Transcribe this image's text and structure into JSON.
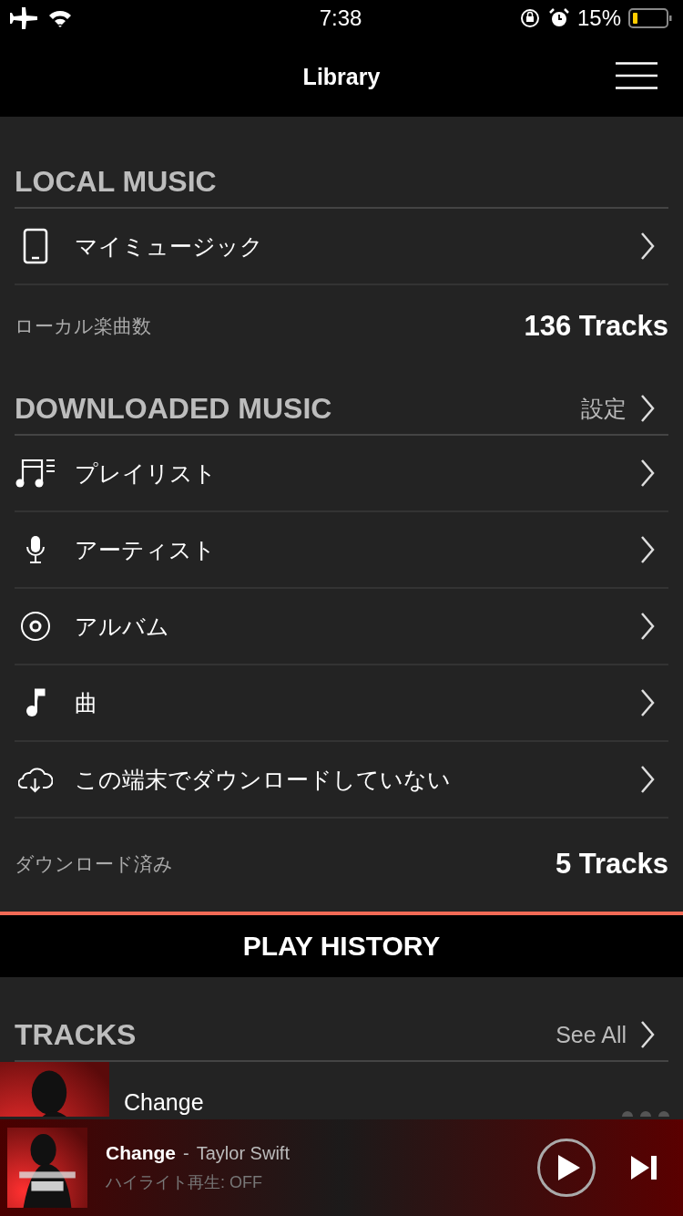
{
  "status_bar": {
    "time": "7:38",
    "battery": "15%"
  },
  "nav": {
    "title": "Library"
  },
  "local_music": {
    "title": "LOCAL MUSIC",
    "items": [
      {
        "kind": "phone",
        "label": "マイミュージック"
      }
    ],
    "count": {
      "label": "ローカル楽曲数",
      "value": "136 Tracks"
    }
  },
  "downloaded_music": {
    "title": "DOWNLOADED MUSIC",
    "link": "設定",
    "items": [
      {
        "kind": "playlist",
        "label": "プレイリスト"
      },
      {
        "kind": "mic",
        "label": "アーティスト"
      },
      {
        "kind": "disc",
        "label": "アルバム"
      },
      {
        "kind": "note",
        "label": "曲"
      },
      {
        "kind": "cloud",
        "label": "この端末でダウンロードしていない"
      }
    ],
    "count": {
      "label": "ダウンロード済み",
      "value": "5 Tracks"
    }
  },
  "play_history": {
    "title": "PLAY HISTORY"
  },
  "tracks": {
    "title": "TRACKS",
    "link": "See All",
    "rows": [
      {
        "title": "Change"
      }
    ]
  },
  "now_playing": {
    "title": "Change",
    "separator": "-",
    "artist": "Taylor Swift",
    "subtitle": "ハイライト再生: OFF"
  }
}
